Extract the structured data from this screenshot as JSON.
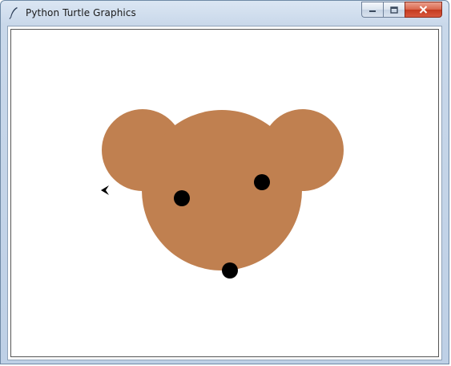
{
  "window": {
    "title": "Python Turtle Graphics",
    "app_icon": "feather-icon",
    "caption_icons": [
      "minimize-icon",
      "maximize-icon",
      "close-icon"
    ]
  },
  "drawing": {
    "face_color": "#c08050",
    "dot_color": "#000000",
    "turtle_cursor": "arrow-cursor-icon",
    "turtle_heading": "left"
  }
}
